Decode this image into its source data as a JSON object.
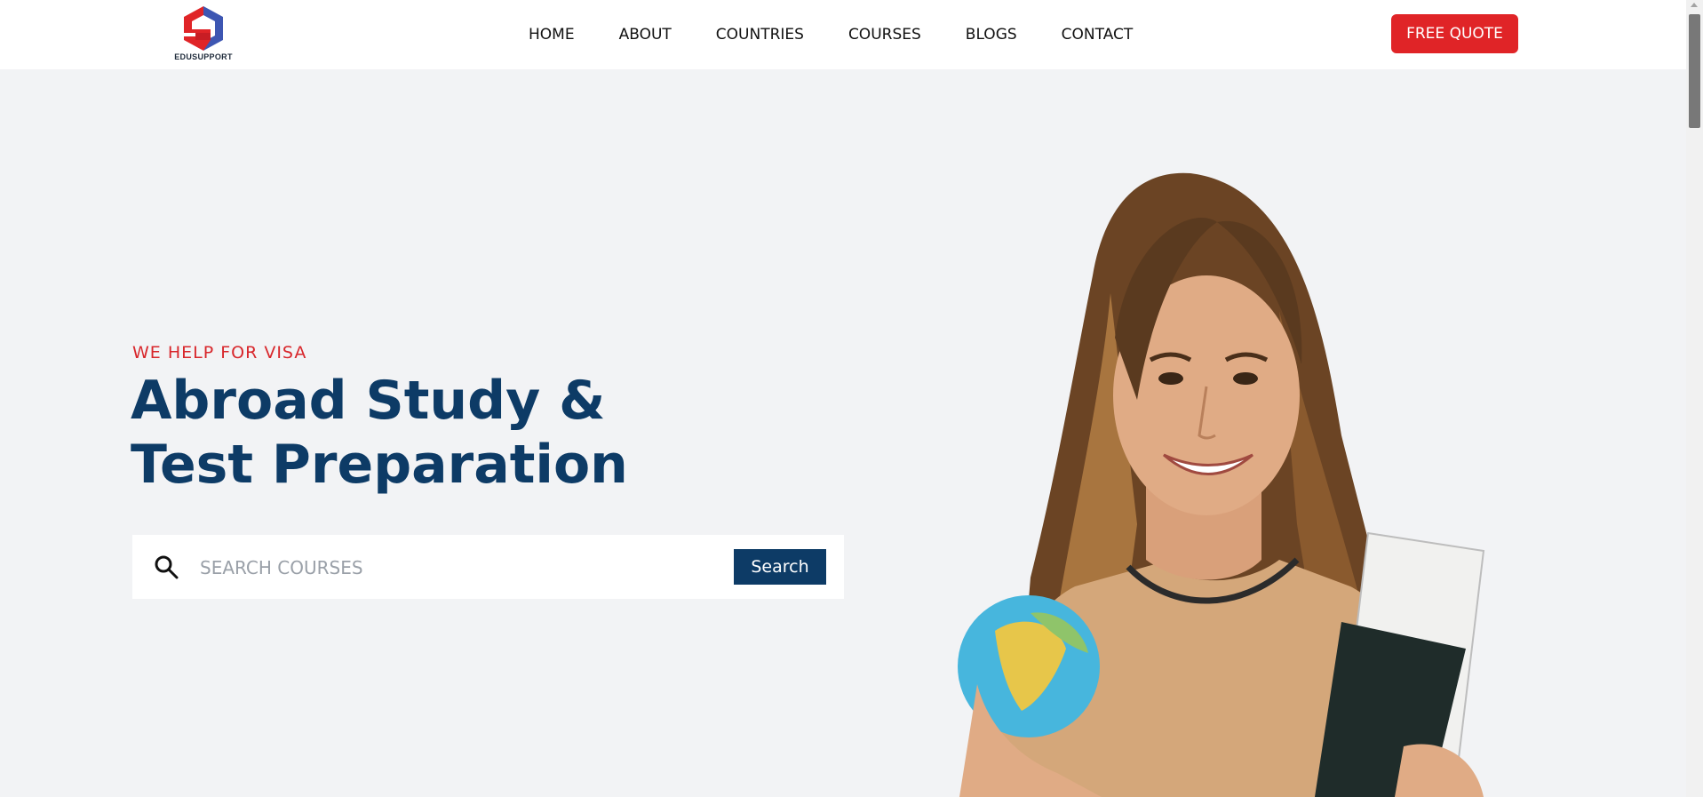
{
  "brand": {
    "name": "EDUSUPPORT"
  },
  "nav": {
    "items": [
      {
        "label": "HOME"
      },
      {
        "label": "ABOUT"
      },
      {
        "label": "COUNTRIES"
      },
      {
        "label": "COURSES"
      },
      {
        "label": "BLOGS"
      },
      {
        "label": "CONTACT"
      }
    ]
  },
  "header": {
    "cta_label": "FREE QUOTE"
  },
  "hero": {
    "eyebrow": "WE HELP FOR VISA",
    "title_line1": "Abroad Study &",
    "title_line2": "Test Preparation",
    "search": {
      "placeholder": "SEARCH COURSES",
      "button_label": "Search"
    },
    "image_alt": "student-holding-globe-and-passport"
  },
  "colors": {
    "accent_red": "#e02427",
    "brand_navy": "#0d3b66",
    "hero_bg": "#f2f3f5"
  }
}
